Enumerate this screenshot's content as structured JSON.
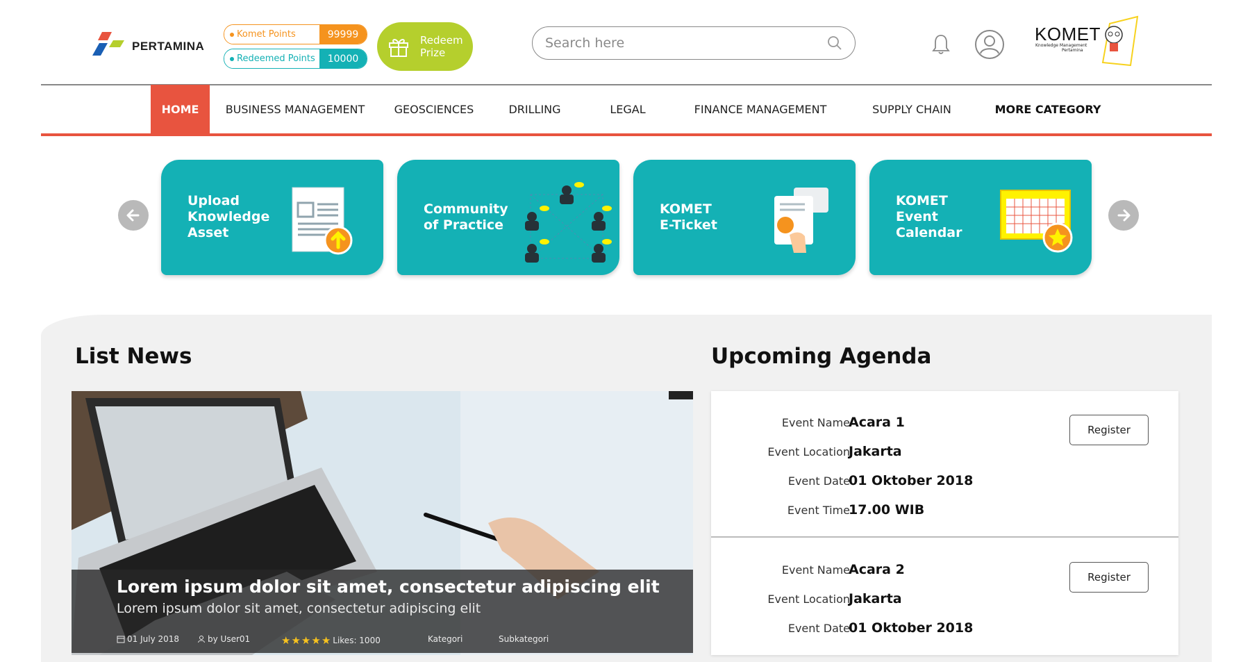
{
  "header": {
    "logo_text": "PERTAMINA",
    "komet_points": {
      "label": "Komet Points",
      "value": "99999"
    },
    "redeemed_points": {
      "label": "Redeemed Points",
      "value": "10000"
    },
    "redeem_button": {
      "line1": "Redeem",
      "line2": "Prize"
    },
    "search": {
      "placeholder": "Search here"
    },
    "komet_logo": {
      "title": "KOMET",
      "subtitle_line1": "Knowledge Management",
      "subtitle_line2": "Pertamina"
    }
  },
  "nav": {
    "items": [
      {
        "label": "HOME",
        "active": true
      },
      {
        "label": "BUSINESS MANAGEMENT"
      },
      {
        "label": "GEOSCIENCES"
      },
      {
        "label": "DRILLING"
      },
      {
        "label": "LEGAL"
      },
      {
        "label": "FINANCE MANAGEMENT"
      },
      {
        "label": "SUPPLY CHAIN"
      },
      {
        "label": "MORE CATEGORY"
      }
    ]
  },
  "carousel": {
    "cards": [
      {
        "line1": "Upload",
        "line2": "Knowledge",
        "line3": "Asset",
        "icon": "document-upload-icon"
      },
      {
        "line1": "Community",
        "line2": "of Practice",
        "icon": "network-people-icon"
      },
      {
        "line1": "KOMET",
        "line2": "E-Ticket",
        "icon": "ticket-icon"
      },
      {
        "line1": "KOMET",
        "line2": "Event",
        "line3": "Calendar",
        "icon": "calendar-star-icon"
      }
    ]
  },
  "news": {
    "heading": "List News",
    "headline": "Lorem ipsum dolor sit amet, consectetur adipiscing elit",
    "summary": "Lorem ipsum dolor sit amet, consectetur adipiscing elit",
    "date": "01 July 2018",
    "author": "by User01",
    "rating": 5,
    "likes": "Likes: 1000",
    "category": "Kategori",
    "subcategory": "Subkategori"
  },
  "agenda": {
    "heading": "Upcoming Agenda",
    "labels": {
      "name": "Event Name",
      "location": "Event Location",
      "date": "Event Date",
      "time": "Event Time"
    },
    "register_label": "Register",
    "events": [
      {
        "name": "Acara 1",
        "location": "Jakarta",
        "date": "01 Oktober 2018",
        "time": "17.00 WIB"
      },
      {
        "name": "Acara 2",
        "location": "Jakarta",
        "date": "01 Oktober 2018"
      }
    ]
  },
  "colors": {
    "primary_teal": "#14b1b5",
    "accent_red": "#e8543f",
    "orange": "#f5931e",
    "green": "#b5cf2d"
  }
}
